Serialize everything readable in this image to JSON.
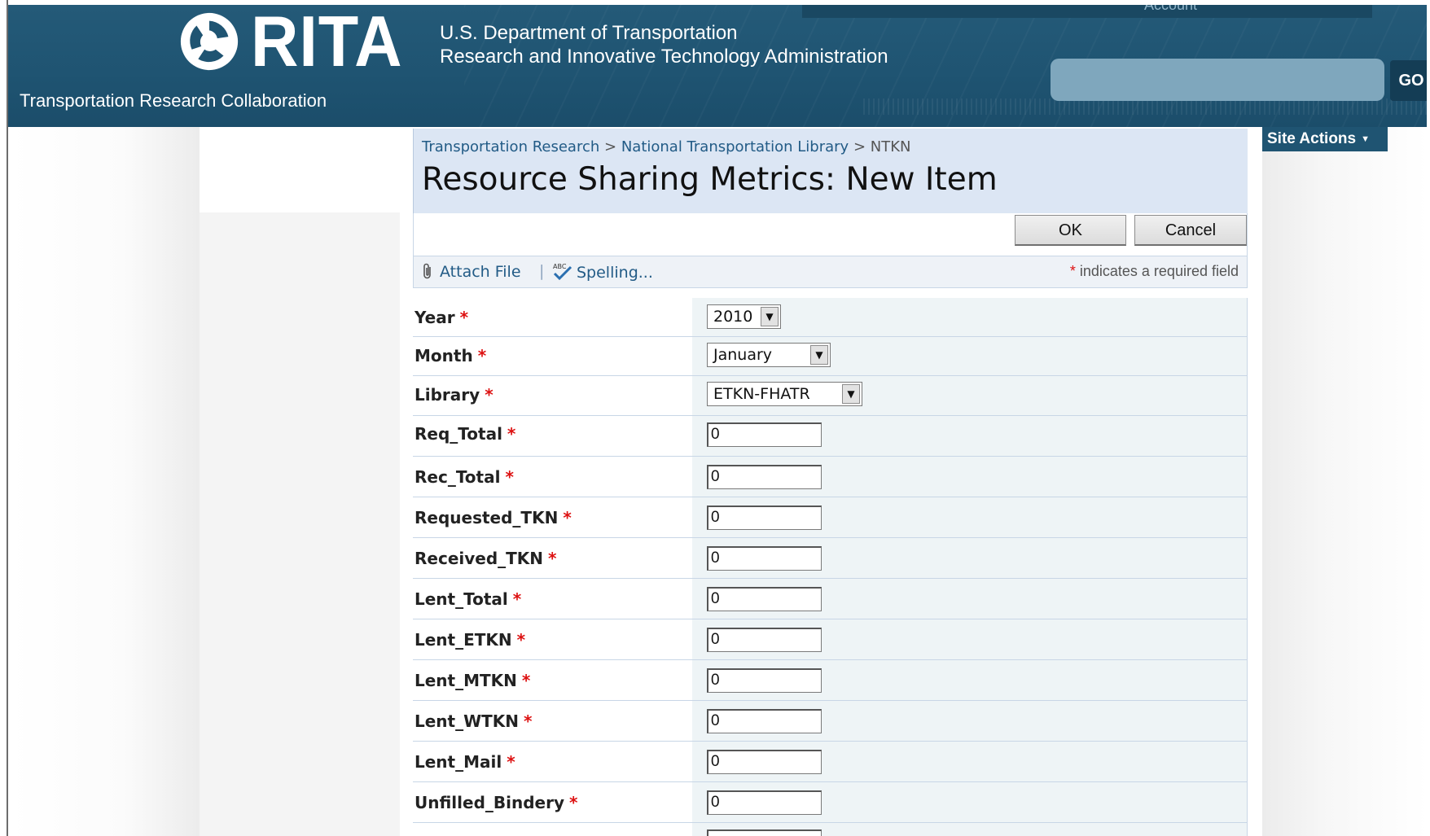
{
  "header": {
    "account_label": "Account",
    "logo_text": "RITA",
    "dept_line1": "U.S. Department of Transportation",
    "dept_line2": "Research and Innovative Technology Administration",
    "collab_title": "Transportation Research Collaboration",
    "search_placeholder": "",
    "go_label": "GO"
  },
  "site_actions": {
    "label": "Site Actions"
  },
  "breadcrumb": {
    "item1": "Transportation Research",
    "item2": "National Transportation Library",
    "current": "NTKN",
    "separator": ">"
  },
  "page_title": "Resource Sharing Metrics: New Item",
  "buttons": {
    "ok": "OK",
    "cancel": "Cancel"
  },
  "toolbar": {
    "attach_label": "Attach File",
    "spelling_label": "Spelling...",
    "divider": "|",
    "req_star": "*",
    "req_note": "indicates a required field"
  },
  "form": {
    "fields": [
      {
        "label": "Year",
        "type": "select",
        "value": "2010",
        "required": "*"
      },
      {
        "label": "Month",
        "type": "select",
        "value": "January",
        "required": "*"
      },
      {
        "label": "Library",
        "type": "select",
        "value": "ETKN-FHATR",
        "required": "*"
      },
      {
        "label": "Req_Total",
        "type": "text",
        "value": "0",
        "required": "*"
      },
      {
        "label": "Rec_Total",
        "type": "text",
        "value": "0",
        "required": "*"
      },
      {
        "label": "Requested_TKN",
        "type": "text",
        "value": "0",
        "required": "*"
      },
      {
        "label": "Received_TKN",
        "type": "text",
        "value": "0",
        "required": "*"
      },
      {
        "label": "Lent_Total",
        "type": "text",
        "value": "0",
        "required": "*"
      },
      {
        "label": "Lent_ETKN",
        "type": "text",
        "value": "0",
        "required": "*"
      },
      {
        "label": "Lent_MTKN",
        "type": "text",
        "value": "0",
        "required": "*"
      },
      {
        "label": "Lent_WTKN",
        "type": "text",
        "value": "0",
        "required": "*"
      },
      {
        "label": "Lent_Mail",
        "type": "text",
        "value": "0",
        "required": "*"
      },
      {
        "label": "Unfilled_Bindery",
        "type": "text",
        "value": "0",
        "required": "*"
      }
    ]
  },
  "colors": {
    "header_bg": "#1f5472",
    "link": "#225b86",
    "required": "#dd1111",
    "title_bg": "#dce6f4"
  }
}
